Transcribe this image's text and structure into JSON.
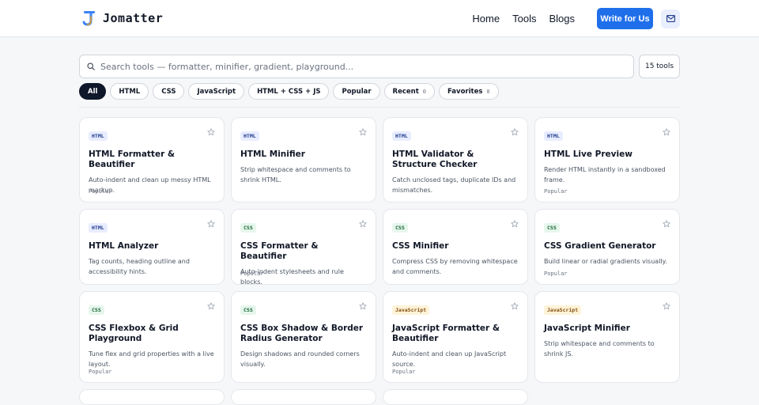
{
  "header": {
    "brand": "Jomatter",
    "logo_letter": "J",
    "nav": [
      "Home",
      "Tools",
      "Blogs"
    ],
    "cta": "Write for Us",
    "mail_icon": "mail-icon"
  },
  "search": {
    "placeholder": "Search tools — formatter, minifier, gradient, playground...",
    "value": "",
    "count": "15 tools"
  },
  "filters": [
    {
      "label": "All",
      "active": true
    },
    {
      "label": "HTML"
    },
    {
      "label": "CSS"
    },
    {
      "label": "JavaScript"
    },
    {
      "label": "HTML + CSS + JS"
    },
    {
      "label": "Popular"
    },
    {
      "label": "Recent",
      "count": "0"
    },
    {
      "label": "Favorites",
      "count": "0"
    }
  ],
  "colors": {
    "accent": "#1f6feb",
    "active_chip": "#0f172a",
    "tag_html": "#e8edff",
    "tag_css": "#e6f6ec",
    "tag_js": "#fdf3d8"
  },
  "cards": [
    {
      "tag": "HTML",
      "title": "HTML Formatter & Beautifier",
      "desc": "Auto-indent and clean up messy HTML markup.",
      "meta": "Popular"
    },
    {
      "tag": "HTML",
      "title": "HTML Minifier",
      "desc": "Strip whitespace and comments to shrink HTML.",
      "meta": ""
    },
    {
      "tag": "HTML",
      "title": "HTML Validator & Structure Checker",
      "desc": "Catch unclosed tags, duplicate IDs and mismatches.",
      "meta": ""
    },
    {
      "tag": "HTML",
      "title": "HTML Live Preview",
      "desc": "Render HTML instantly in a sandboxed frame.",
      "meta": "Popular"
    },
    {
      "tag": "HTML",
      "title": "HTML Analyzer",
      "desc": "Tag counts, heading outline and accessibility hints.",
      "meta": ""
    },
    {
      "tag": "CSS",
      "title": "CSS Formatter & Beautifier",
      "desc": "Auto-indent stylesheets and rule blocks.",
      "meta": "Popular"
    },
    {
      "tag": "CSS",
      "title": "CSS Minifier",
      "desc": "Compress CSS by removing whitespace and comments.",
      "meta": ""
    },
    {
      "tag": "CSS",
      "title": "CSS Gradient Generator",
      "desc": "Build linear or radial gradients visually.",
      "meta": "Popular"
    },
    {
      "tag": "CSS",
      "title": "CSS Flexbox & Grid Playground",
      "desc": "Tune flex and grid properties with a live layout.",
      "meta": "Popular"
    },
    {
      "tag": "CSS",
      "title": "CSS Box Shadow & Border Radius Generator",
      "desc": "Design shadows and rounded corners visually.",
      "meta": ""
    },
    {
      "tag": "JavaScript",
      "title": "JavaScript Formatter & Beautifier",
      "desc": "Auto-indent and clean up JavaScript source.",
      "meta": "Popular"
    },
    {
      "tag": "JavaScript",
      "title": "JavaScript Minifier",
      "desc": "Strip whitespace and comments to shrink JS.",
      "meta": ""
    }
  ]
}
